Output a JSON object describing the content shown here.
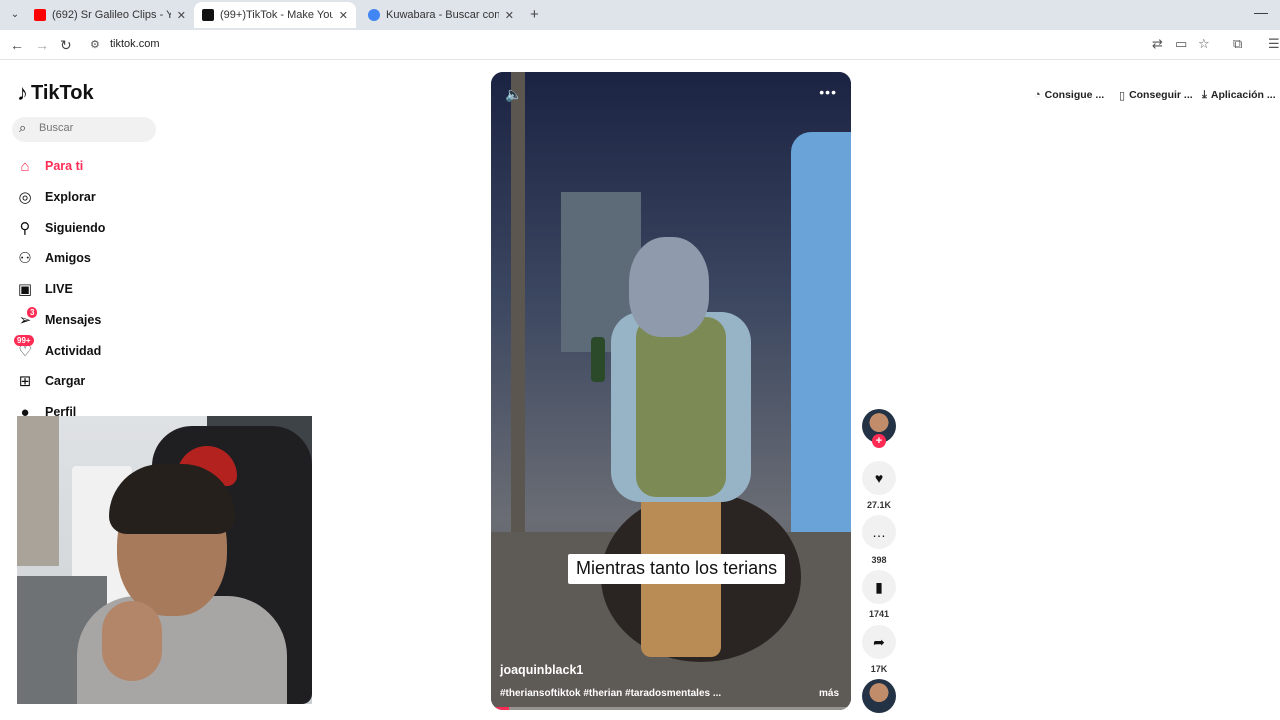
{
  "browser": {
    "tabs": [
      {
        "title": "(692) Sr Galileo Clips - YouTube",
        "favicon_color": "#ff0000"
      },
      {
        "title": "(99+)TikTok - Make Your Day",
        "favicon_color": "#111111"
      },
      {
        "title": "Kuwabara - Buscar con Google",
        "favicon_color": "#4285f4"
      }
    ],
    "new_tab": "+",
    "url": "tiktok.com"
  },
  "tiktok": {
    "brand": "TikTok",
    "search_placeholder": "Buscar",
    "nav": [
      {
        "label": "Para ti",
        "icon": "home-icon"
      },
      {
        "label": "Explorar",
        "icon": "compass-icon"
      },
      {
        "label": "Siguiendo",
        "icon": "following-icon"
      },
      {
        "label": "Amigos",
        "icon": "friends-icon"
      },
      {
        "label": "LIVE",
        "icon": "live-icon"
      },
      {
        "label": "Mensajes",
        "icon": "messages-icon",
        "badge": "3"
      },
      {
        "label": "Actividad",
        "icon": "activity-icon",
        "badge": "99+"
      },
      {
        "label": "Cargar",
        "icon": "upload-icon"
      },
      {
        "label": "Perfil",
        "icon": "profile-icon"
      }
    ],
    "top_right": [
      {
        "label": "Consigue ...",
        "icon": "coin-icon"
      },
      {
        "label": "Conseguir ...",
        "icon": "phone-icon"
      },
      {
        "label": "Aplicación ...",
        "icon": "download-icon"
      }
    ],
    "video": {
      "caption": "Mientras tanto los terians",
      "author": "joaquinblack1",
      "tags": "#theriansoftiktok #therian #taradosmentales ...",
      "more": "más",
      "progress": 0.05
    },
    "actions": {
      "likes": "27.1K",
      "comments": "398",
      "saves": "1741",
      "shares": "17K"
    }
  }
}
